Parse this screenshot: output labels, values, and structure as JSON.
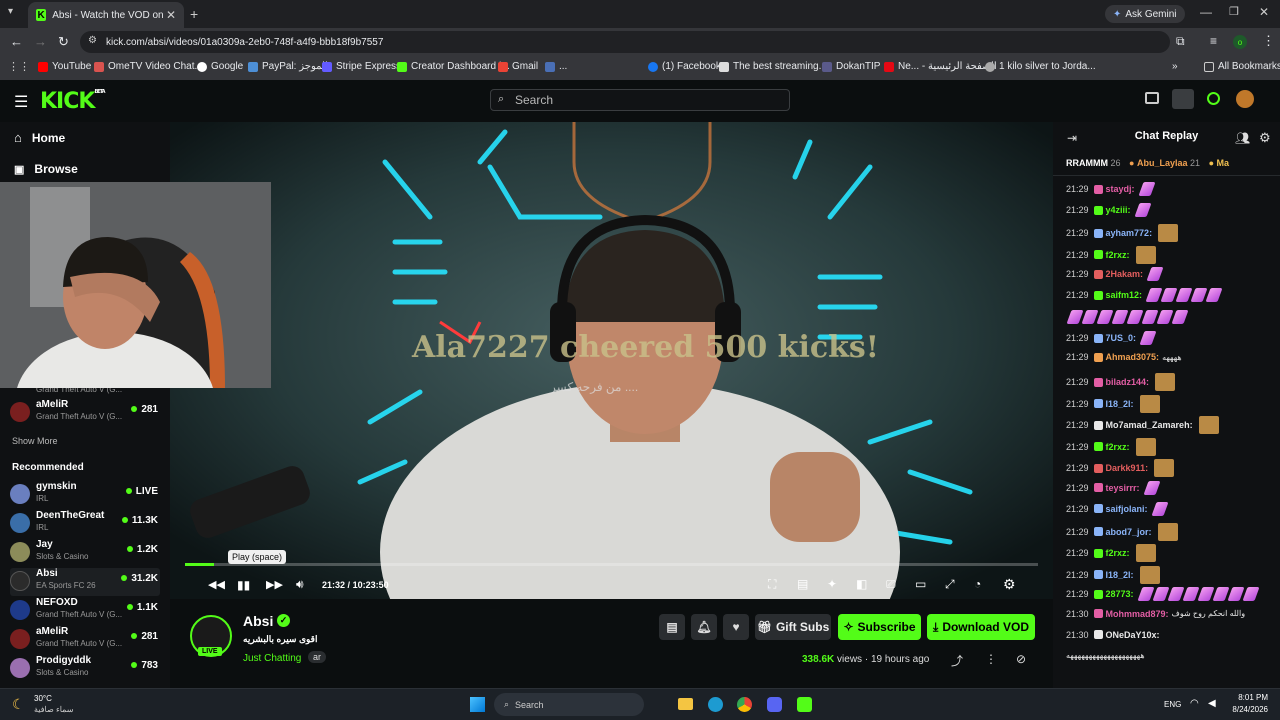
{
  "browser": {
    "tab_title": "Absi - Watch the VOD on Kick",
    "url": "kick.com/absi/videos/01a0309a-2eb0-748f-a4f9-bbb18f9b7557",
    "ask_gemini": "Ask Gemini",
    "bookmarks": [
      "YouTube",
      "OmeTV Video Chat...",
      "Google",
      "PayPal: الموجز",
      "Stripe Express",
      "Creator Dashboard |...",
      "Gmail",
      "...",
      "(1) Facebook",
      "The best streaming...",
      "DokanTIP",
      "Ne... - الصفحة الرئيسية",
      "1 kilo silver to Jorda..."
    ],
    "all_bookmarks": "All Bookmarks"
  },
  "kick": {
    "logo": "KICK",
    "logo_beta": "BETA",
    "search_placeholder": "Search"
  },
  "sidebar": {
    "home": "Home",
    "browse": "Browse",
    "partial_item": {
      "category": "Grand Theft Auto V (G..."
    },
    "following_items": [
      {
        "name": "aMeliR",
        "category": "Grand Theft Auto V (G...",
        "viewers": "281"
      }
    ],
    "show_more": "Show More",
    "recommended_title": "Recommended",
    "recommended": [
      {
        "name": "gymskin",
        "category": "IRL",
        "viewers": "LIVE",
        "color": "#6a7fbf"
      },
      {
        "name": "DeenTheGreat",
        "category": "IRL",
        "viewers": "11.3K",
        "color": "#3a6ea8"
      },
      {
        "name": "Jay",
        "category": "Slots & Casino",
        "viewers": "1.2K",
        "color": "#8c8c5a"
      },
      {
        "name": "Absi",
        "category": "EA Sports FC 26",
        "viewers": "31.2K",
        "color": "#2b2b2b"
      },
      {
        "name": "NEFOXD",
        "category": "Grand Theft Auto V (G...",
        "viewers": "1.1K",
        "color": "#1e3a8a"
      },
      {
        "name": "aMeliR",
        "category": "Grand Theft Auto V (G...",
        "viewers": "281",
        "color": "#7a1f1f"
      },
      {
        "name": "Prodigyddk",
        "category": "Slots & Casino",
        "viewers": "783",
        "color": "#9a6fb0"
      }
    ]
  },
  "video": {
    "overlay_text": "Ala7227 cheered 500 kicks!",
    "overlay_sub": "من فرحه كسر ....",
    "tooltip": "Play (space)",
    "time_current": "21:32",
    "time_sep": "/",
    "time_total": "10:23:50",
    "progress": 0.034
  },
  "channel": {
    "name": "Absi",
    "title": "اقوى سيره بالبشريه",
    "category": "Just Chatting",
    "tag": "ar",
    "live_badge": "LIVE",
    "gift_subs": "Gift Subs",
    "subscribe": "Subscribe",
    "download": "Download VOD",
    "views": "338.6K",
    "views_label": "views",
    "age": "19 hours ago"
  },
  "chat": {
    "title": "Chat Replay",
    "pinned": [
      {
        "user": "RRAMMM",
        "count": "26"
      },
      {
        "user": "Abu_Laylaa",
        "count": "21"
      },
      {
        "user": "Ma",
        "count": ""
      }
    ],
    "messages": [
      {
        "time": "21:29",
        "user": "staydj:",
        "color": "#e35ea5",
        "text": "",
        "emotes": 1
      },
      {
        "time": "21:29",
        "user": "y4ziii:",
        "color": "#53fc18",
        "text": "",
        "emotes": 1
      },
      {
        "time": "21:29",
        "user": "ayham772:",
        "color": "#8ab4f8",
        "text": "",
        "emotes": 0,
        "face": true
      },
      {
        "time": "21:29",
        "user": "f2rxz:",
        "color": "#53fc18",
        "text": "",
        "emotes": 0,
        "face": true
      },
      {
        "time": "21:29",
        "user": "2Hakam:",
        "color": "#e35e5e",
        "text": "",
        "emotes": 1
      },
      {
        "time": "21:29",
        "user": "saifm12:",
        "color": "#53fc18",
        "text": "",
        "emotes": 5
      },
      {
        "time": "",
        "user": "",
        "color": "#fff",
        "text": "",
        "emotes": 8
      },
      {
        "time": "21:29",
        "user": "7US_0:",
        "color": "#8ab4f8",
        "text": "",
        "emotes": 1
      },
      {
        "time": "21:29",
        "user": "Ahmad3075:",
        "color": "#f0a050",
        "text": "ههههه",
        "emotes": 0
      },
      {
        "time": "21:29",
        "user": "biladz144:",
        "color": "#e35ea5",
        "text": "",
        "emotes": 0,
        "face": true
      },
      {
        "time": "21:29",
        "user": "I18_2l:",
        "color": "#8ab4f8",
        "text": "",
        "emotes": 0,
        "face": true
      },
      {
        "time": "21:29",
        "user": "Mo7amad_Zamareh:",
        "color": "#e8e8e8",
        "text": "",
        "emotes": 0,
        "face": true
      },
      {
        "time": "21:29",
        "user": "f2rxz:",
        "color": "#53fc18",
        "text": "",
        "emotes": 0,
        "face": true
      },
      {
        "time": "21:29",
        "user": "Darkk911:",
        "color": "#e35e5e",
        "text": "",
        "emotes": 0,
        "face": true
      },
      {
        "time": "21:29",
        "user": "teysirrr:",
        "color": "#e35ea5",
        "text": "",
        "emotes": 1
      },
      {
        "time": "21:29",
        "user": "saifjolani:",
        "color": "#8ab4f8",
        "text": "",
        "emotes": 1
      },
      {
        "time": "21:29",
        "user": "abod7_jor:",
        "color": "#8ab4f8",
        "text": "",
        "emotes": 0,
        "face": true
      },
      {
        "time": "21:29",
        "user": "f2rxz:",
        "color": "#53fc18",
        "text": "",
        "emotes": 0,
        "face": true
      },
      {
        "time": "21:29",
        "user": "I18_2l:",
        "color": "#8ab4f8",
        "text": "",
        "emotes": 0,
        "face": true
      },
      {
        "time": "21:29",
        "user": "28773:",
        "color": "#53fc18",
        "text": "",
        "emotes": 8
      },
      {
        "time": "21:30",
        "user": "Mohmmad879:",
        "color": "#e35ea5",
        "text": "والله انحكم روح شوف",
        "emotes": 0
      },
      {
        "time": "21:30",
        "user": "ONeDaY10x:",
        "color": "#e8e8e8",
        "text": "",
        "emotes": 0
      },
      {
        "time": "",
        "user": "",
        "color": "#e8e8e8",
        "text": "ههههههههههههههههههههه",
        "emotes": 0
      }
    ]
  },
  "taskbar": {
    "temp": "30°C",
    "weather": "سماء صافية",
    "search": "Search",
    "lang": "ENG",
    "time": "8:01 PM",
    "date": "8/24/2026"
  },
  "colors": {
    "kick_green": "#53fc18",
    "bg": "#0b0e0f",
    "panel": "#0f1113"
  }
}
